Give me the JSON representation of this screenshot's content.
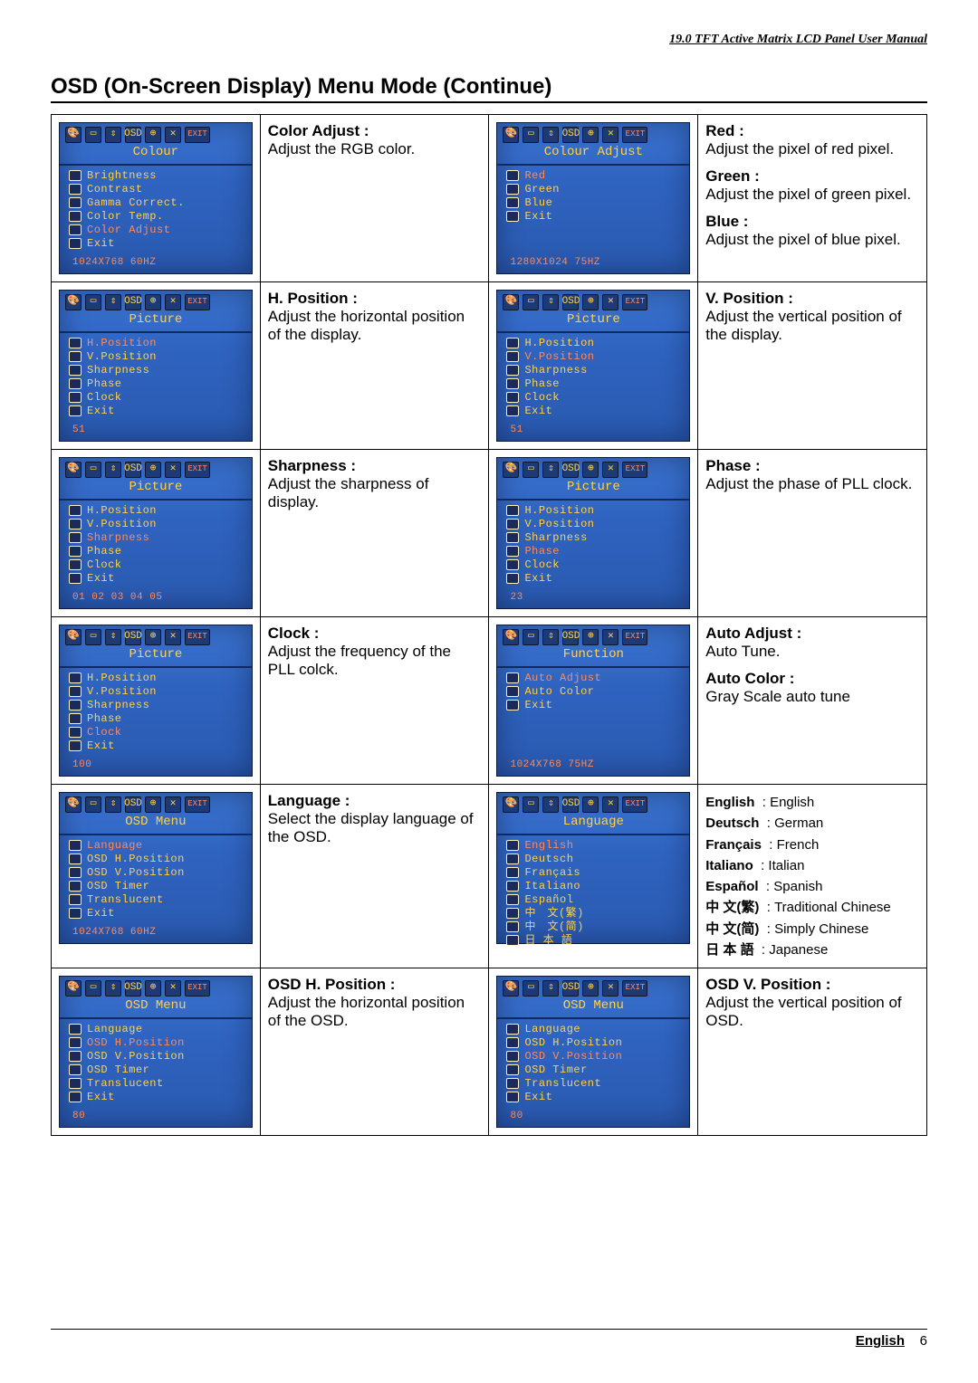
{
  "doc": {
    "manual_title": "19.0 TFT Active Matrix LCD Panel User Manual",
    "section_title": "OSD (On-Screen Display) Menu Mode (Continue)",
    "footer_lang": "English",
    "footer_page": "6"
  },
  "osd": {
    "colour": {
      "title": "Colour",
      "items": [
        "Brightness",
        "Contrast",
        "Gamma Correct.",
        "Color Temp.",
        "Color Adjust",
        "Exit"
      ],
      "selected": 4,
      "footer": "1024X768  60HZ",
      "desc_label": "Color Adjust :",
      "desc_text": "Adjust the RGB color."
    },
    "colour_adjust": {
      "title": "Colour Adjust",
      "items": [
        "Red",
        "Green",
        "Blue",
        "Exit"
      ],
      "selected": 0,
      "footer": "1280X1024 75HZ",
      "descs": [
        {
          "label": "Red :",
          "text": "Adjust the pixel of red pixel."
        },
        {
          "label": "Green :",
          "text": "Adjust the pixel of green pixel."
        },
        {
          "label": "Blue :",
          "text": "Adjust the pixel of blue pixel."
        }
      ]
    },
    "picture_h": {
      "title": "Picture",
      "items": [
        "H.Position",
        "V.Position",
        "Sharpness",
        "Phase",
        "Clock",
        "Exit"
      ],
      "selected": 0,
      "footer": "51",
      "desc_label": "H. Position :",
      "desc_text": "Adjust the horizontal position of the display."
    },
    "picture_v": {
      "title": "Picture",
      "items": [
        "H.Position",
        "V.Position",
        "Sharpness",
        "Phase",
        "Clock",
        "Exit"
      ],
      "selected": 1,
      "footer": "51",
      "desc_label": "V. Position :",
      "desc_text": "Adjust the vertical position of the display."
    },
    "picture_sharp": {
      "title": "Picture",
      "items": [
        "H.Position",
        "V.Position",
        "Sharpness",
        "Phase",
        "Clock",
        "Exit"
      ],
      "selected": 2,
      "footer": "01  02  03  04  05",
      "desc_label": "Sharpness :",
      "desc_text": "Adjust the sharpness of display."
    },
    "picture_phase": {
      "title": "Picture",
      "items": [
        "H.Position",
        "V.Position",
        "Sharpness",
        "Phase",
        "Clock",
        "Exit"
      ],
      "selected": 3,
      "footer": "23",
      "desc_label": "Phase :",
      "desc_text": "Adjust the phase of PLL clock."
    },
    "picture_clock": {
      "title": "Picture",
      "items": [
        "H.Position",
        "V.Position",
        "Sharpness",
        "Phase",
        "Clock",
        "Exit"
      ],
      "selected": 4,
      "footer": "100",
      "desc_label": "Clock :",
      "desc_text": "Adjust the frequency of the PLL colck."
    },
    "function": {
      "title": "Function",
      "items": [
        "Auto Adjust",
        "Auto Color",
        "Exit"
      ],
      "selected": 0,
      "footer": "1024X768  75HZ",
      "descs": [
        {
          "label": "Auto Adjust :",
          "text": "Auto Tune."
        },
        {
          "label": "Auto Color :",
          "text": "Gray Scale auto tune"
        }
      ]
    },
    "osd_menu": {
      "title": "OSD Menu",
      "items": [
        "Language",
        "OSD H.Position",
        "OSD V.Position",
        "OSD Timer",
        "Translucent",
        "Exit"
      ],
      "selected": 0,
      "footer": "1024X768  60HZ",
      "desc_label": "Language :",
      "desc_text": "Select the display language of the OSD."
    },
    "language_menu": {
      "title": "Language",
      "items": [
        "English",
        "Deutsch",
        "Français",
        "Italiano",
        "Español",
        "中　文(繁)",
        "中　文(简)",
        "日 本 語"
      ],
      "selected": 0,
      "lang_map": [
        {
          "k": "English",
          "v": ": English"
        },
        {
          "k": "Deutsch",
          "v": ": German"
        },
        {
          "k": "Français",
          "v": ": French"
        },
        {
          "k": "Italiano",
          "v": ": Italian"
        },
        {
          "k": "Español",
          "v": ": Spanish"
        },
        {
          "k": "中 文(繁)",
          "v": ": Traditional Chinese"
        },
        {
          "k": "中 文(简)",
          "v": ": Simply Chinese"
        },
        {
          "k": "日 本 語",
          "v": ": Japanese"
        }
      ]
    },
    "osd_menu_h": {
      "title": "OSD Menu",
      "items": [
        "Language",
        "OSD H.Position",
        "OSD V.Position",
        "OSD Timer",
        "Translucent",
        "Exit"
      ],
      "selected": 1,
      "footer": "80",
      "desc_label": "OSD H. Position :",
      "desc_text": "Adjust the horizontal position of the OSD."
    },
    "osd_menu_v": {
      "title": "OSD Menu",
      "items": [
        "Language",
        "OSD H.Position",
        "OSD V.Position",
        "OSD Timer",
        "Translucent",
        "Exit"
      ],
      "selected": 2,
      "footer": "80",
      "desc_label": "OSD V. Position :",
      "desc_text": "Adjust the vertical position of OSD."
    }
  }
}
